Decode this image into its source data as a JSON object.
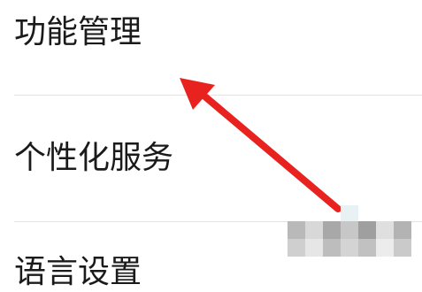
{
  "settings_menu": {
    "items": [
      {
        "label": "功能管理"
      },
      {
        "label": "个性化服务"
      },
      {
        "label": "语言设置"
      }
    ]
  },
  "annotation": {
    "arrow_color": "#e8231f",
    "arrow_icon": "arrow-up-left-icon"
  },
  "watermark": {
    "style": "pixelated-mosaic"
  }
}
